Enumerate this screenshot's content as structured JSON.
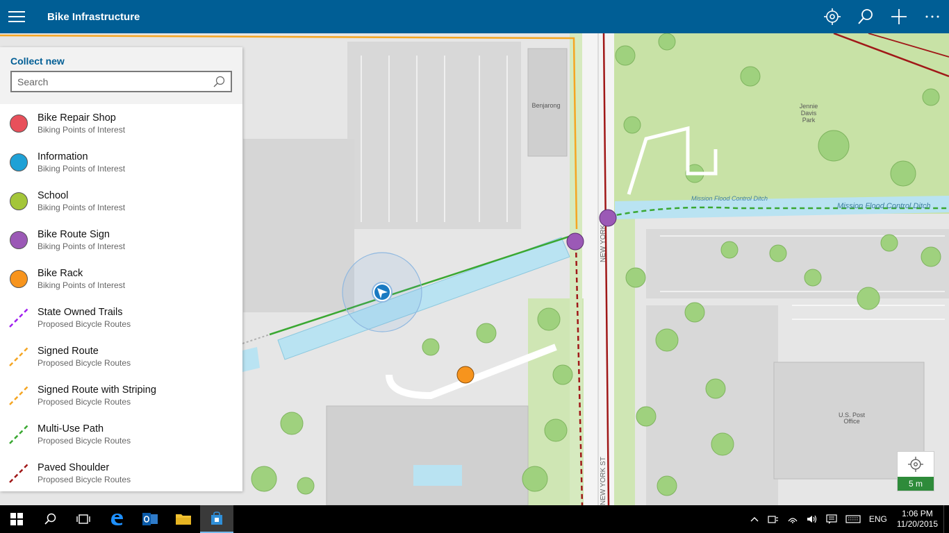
{
  "app": {
    "title": "Bike Infrastructure"
  },
  "panel": {
    "title": "Collect new",
    "search_placeholder": "Search",
    "items": [
      {
        "name": "Bike Repair Shop",
        "sub": "Biking Points of Interest",
        "kind": "dot",
        "color": "#e8505b"
      },
      {
        "name": "Information",
        "sub": "Biking Points of Interest",
        "kind": "dot",
        "color": "#1fa1d6"
      },
      {
        "name": "School",
        "sub": "Biking Points of Interest",
        "kind": "dot",
        "color": "#a4c639"
      },
      {
        "name": "Bike Route Sign",
        "sub": "Biking Points of Interest",
        "kind": "dot",
        "color": "#9b59b6"
      },
      {
        "name": "Bike Rack",
        "sub": "Biking Points of Interest",
        "kind": "dot",
        "color": "#f7941d"
      },
      {
        "name": "State Owned Trails",
        "sub": "Proposed Bicycle Routes",
        "kind": "line",
        "color": "#a020f0"
      },
      {
        "name": "Signed Route",
        "sub": "Proposed Bicycle Routes",
        "kind": "line",
        "color": "#f5a623"
      },
      {
        "name": "Signed Route with Striping",
        "sub": "Proposed Bicycle Routes",
        "kind": "line",
        "color": "#f5a623"
      },
      {
        "name": "Multi-Use Path",
        "sub": "Proposed Bicycle Routes",
        "kind": "line",
        "color": "#3aa832"
      },
      {
        "name": "Paved Shoulder",
        "sub": "Proposed Bicycle Routes",
        "kind": "line",
        "color": "#a01818"
      }
    ]
  },
  "map": {
    "labels": {
      "benjarong": "Benjarong",
      "park": [
        "Jennie",
        "Davis",
        "Park"
      ],
      "ditch1": "Mission Flood Control Ditch",
      "ditch2": "Mission Flood Control Ditch",
      "street1": "NEW YORK ST",
      "street2": "NEW YORK ST",
      "postoffice": [
        "U.S. Post",
        "Office"
      ]
    },
    "scale_label": "5 m"
  },
  "taskbar": {
    "lang": "ENG",
    "time": "1:06 PM",
    "date": "11/20/2015"
  }
}
